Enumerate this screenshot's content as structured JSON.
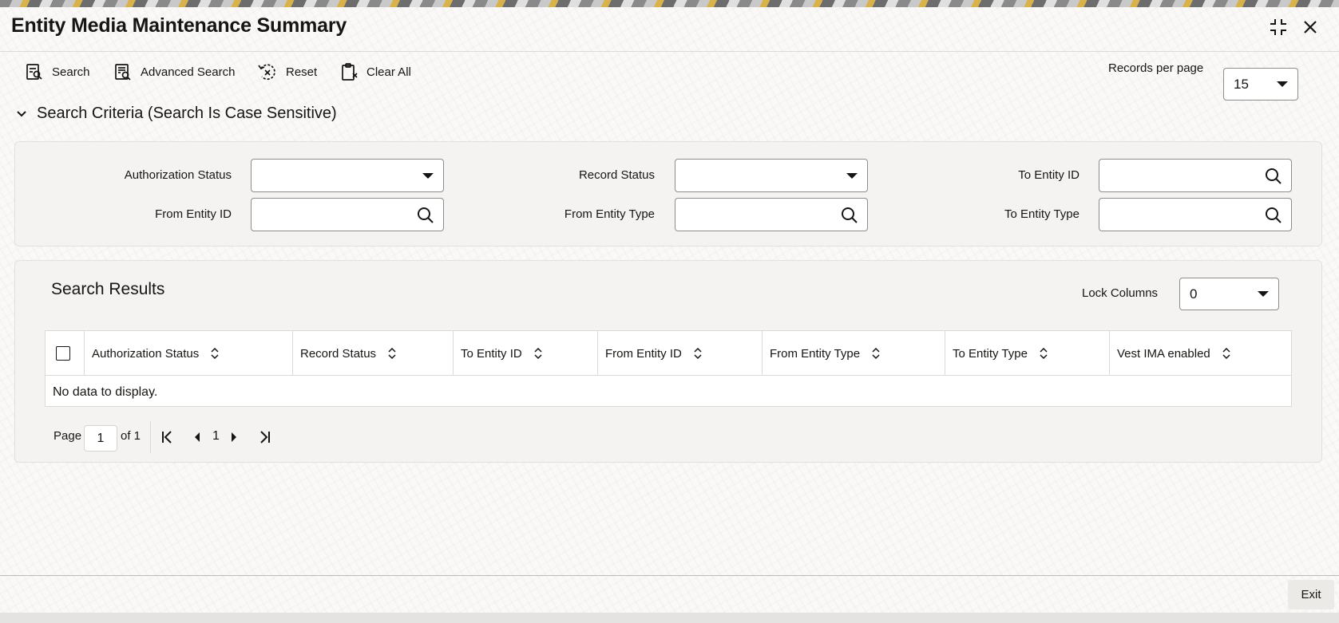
{
  "window": {
    "title": "Entity Media Maintenance Summary",
    "maximize_icon": "collapse-corners-icon",
    "close_icon": "close-icon"
  },
  "toolbar": {
    "search_label": "Search",
    "advanced_search_label": "Advanced Search",
    "reset_label": "Reset",
    "clear_all_label": "Clear All",
    "records_per_page_label": "Records per page",
    "records_per_page_value": "15"
  },
  "criteria": {
    "header": "Search Criteria (Search Is Case Sensitive)",
    "fields": {
      "authorization_status": "Authorization Status",
      "record_status": "Record Status",
      "to_entity_id": "To Entity ID",
      "from_entity_id": "From Entity ID",
      "from_entity_type": "From Entity Type",
      "to_entity_type": "To Entity Type"
    }
  },
  "results": {
    "title": "Search Results",
    "lock_columns_label": "Lock Columns",
    "lock_columns_value": "0",
    "columns": [
      "Authorization Status",
      "Record Status",
      "To Entity ID",
      "From Entity ID",
      "From Entity Type",
      "To Entity Type",
      "Vest IMA enabled"
    ],
    "empty_message": "No data to display."
  },
  "pager": {
    "page_label": "Page",
    "page_value": "1",
    "of_label": "of 1",
    "current_page": "1"
  },
  "footer": {
    "exit_label": "Exit"
  },
  "colors": {
    "text": "#161513",
    "panel": "#f4f3f1",
    "border": "#8e8d8a"
  }
}
